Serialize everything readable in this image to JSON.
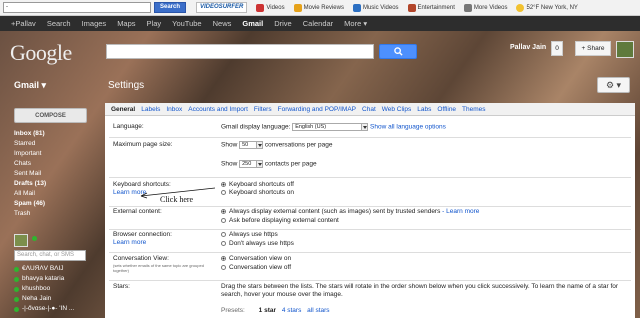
{
  "toolbar": {
    "search_value": "-",
    "search_button": "Search",
    "video_logo": "VIDEOSURFER",
    "items": [
      "Videos",
      "Movie Reviews",
      "Music Videos",
      "Entertainment",
      "More Videos",
      "52°F New York, NY"
    ]
  },
  "gnav": {
    "items": [
      "+Pallav",
      "Search",
      "Images",
      "Maps",
      "Play",
      "YouTube",
      "News",
      "Gmail",
      "Drive",
      "Calendar",
      "More ▾"
    ],
    "active": "Gmail"
  },
  "header": {
    "logo": "Google",
    "user": "Pallav Jain",
    "count": "0",
    "share": "+ Share"
  },
  "left": {
    "app": "Gmail ▾",
    "compose": "COMPOSE",
    "labels": [
      {
        "text": "Inbox (81)",
        "bold": true
      },
      {
        "text": "Starred",
        "bold": false
      },
      {
        "text": "Important",
        "bold": false
      },
      {
        "text": "Chats",
        "bold": false
      },
      {
        "text": "Sent Mail",
        "bold": false
      },
      {
        "text": "Drafts (13)",
        "bold": true
      },
      {
        "text": "All Mail",
        "bold": false
      },
      {
        "text": "Spam (46)",
        "bold": true
      },
      {
        "text": "Trash",
        "bold": false
      }
    ],
    "chat_search_placeholder": "Search, chat, or SMS",
    "contacts": [
      "€ΛUЯΛV ВΛIJ",
      "bhavya kataria",
      "khushboo",
      "Neha Jain",
      "-|-ővɑse-|-●- 'IN ..."
    ]
  },
  "settings": {
    "title": "Settings",
    "gear_label": "⚙ ▾",
    "tabs": [
      "General",
      "Labels",
      "Inbox",
      "Accounts and Import",
      "Filters",
      "Forwarding and POP/IMAP",
      "Chat",
      "Web Clips",
      "Labs",
      "Offline",
      "Themes"
    ],
    "active_tab": "General",
    "language_label": "Language:",
    "language_sub": "Gmail display language:",
    "language_value": "English (US)",
    "language_link": "Show all language options",
    "pagesize_label": "Maximum page size:",
    "show1": "Show",
    "show1_value": "50",
    "show1_unit": "conversations per page",
    "show2": "Show",
    "show2_value": "250",
    "show2_unit": "contacts per page",
    "kb_label": "Keyboard shortcuts:",
    "kb_learn": "Learn more",
    "kb_off": "Keyboard shortcuts off",
    "kb_on": "Keyboard shortcuts on",
    "click_here": "Click here",
    "ext_label": "External content:",
    "ext_opt1": "Always display external content (such as images) sent by trusted senders",
    "ext_link": "- Learn more",
    "ext_opt2": "Ask before displaying external content",
    "browser_label": "Browser connection:",
    "browser_learn": "Learn more",
    "browser_opt1": "Always use https",
    "browser_opt2": "Don't always use https",
    "conv_label": "Conversation View:",
    "conv_sub": "(sets whether emails of the same topic are grouped together)",
    "conv_on": "Conversation view on",
    "conv_off": "Conversation view off",
    "stars_label": "Stars:",
    "stars_text": "Drag the stars between the lists. The stars will rotate in the order shown below when you click successively. To learn the name of a star for search, hover your mouse over the image.",
    "presets": "Presets:",
    "p1": "1 star",
    "p4": "4 stars",
    "pall": "all stars"
  }
}
